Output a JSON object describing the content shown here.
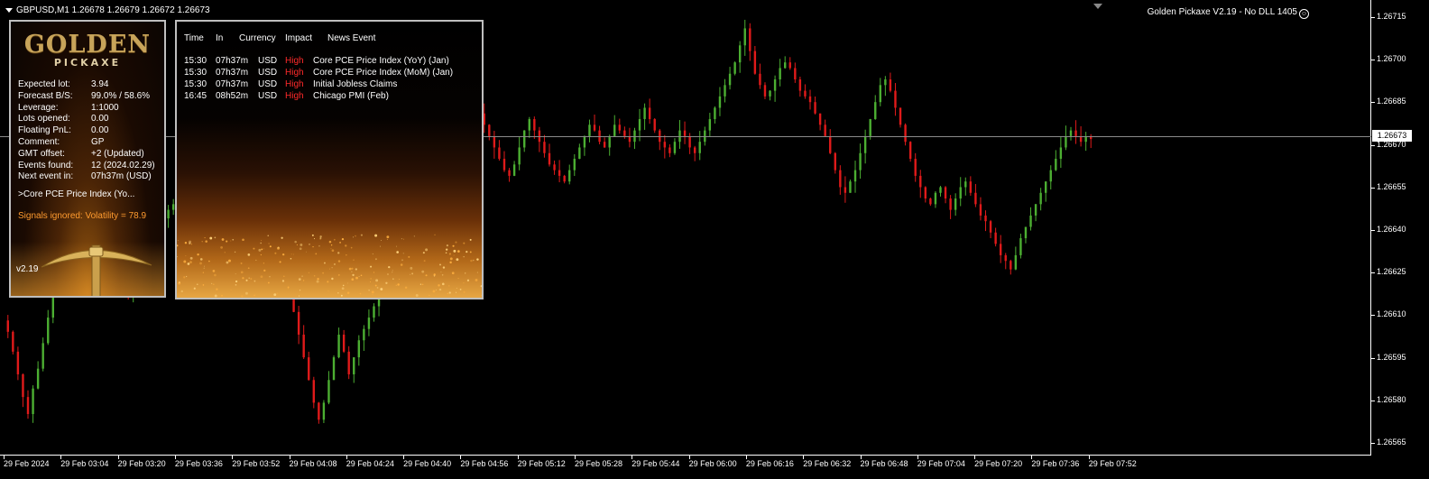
{
  "header": {
    "symbol_info": "GBPUSD,M1  1.26678 1.26679 1.26672 1.26673",
    "ea_title": "Golden Pickaxe V2.19 - No DLL 1405"
  },
  "price_axis": {
    "ticks": [
      "1.26715",
      "1.26700",
      "1.26685",
      "1.26670",
      "1.26655",
      "1.26640",
      "1.26625",
      "1.26610",
      "1.26595",
      "1.26580",
      "1.26565"
    ],
    "current_price": "1.26673"
  },
  "time_axis": {
    "ticks": [
      "29 Feb 2024",
      "29 Feb 03:04",
      "29 Feb 03:20",
      "29 Feb 03:36",
      "29 Feb 03:52",
      "29 Feb 04:08",
      "29 Feb 04:24",
      "29 Feb 04:40",
      "29 Feb 04:56",
      "29 Feb 05:12",
      "29 Feb 05:28",
      "29 Feb 05:44",
      "29 Feb 06:00",
      "29 Feb 06:16",
      "29 Feb 06:32",
      "29 Feb 06:48",
      "29 Feb 07:04",
      "29 Feb 07:20",
      "29 Feb 07:36",
      "29 Feb 07:52"
    ]
  },
  "colors": {
    "bull": "#4caf32",
    "bear": "#e01a1a",
    "accent": "#ff9b2f",
    "high_impact": "#ff2a2a"
  },
  "gp_panel": {
    "logo_main": "GOLDEN",
    "logo_sub": "PICKAXE",
    "rows": [
      {
        "label": "Expected lot:",
        "value": "3.94"
      },
      {
        "label": "Forecast B/S:",
        "value": "99.0% / 58.6%"
      },
      {
        "label": "Leverage:",
        "value": "1:1000"
      },
      {
        "label": "Lots opened:",
        "value": "0.00"
      },
      {
        "label": "Floating PnL:",
        "value": "0.00"
      },
      {
        "label": "Comment:",
        "value": "GP"
      },
      {
        "label": "GMT offset:",
        "value": "+2 (Updated)"
      },
      {
        "label": "Events found:",
        "value": "12 (2024.02.29)"
      },
      {
        "label": "Next event in:",
        "value": "07h37m (USD)"
      }
    ],
    "next_event": ">Core PCE Price Index (Yo...",
    "signal": "Signals ignored: Volatility = 78.9",
    "version": "v2.19"
  },
  "news_panel": {
    "headers": {
      "time": "Time",
      "in": "In",
      "currency": "Currency",
      "impact": "Impact",
      "event": "News Event"
    },
    "events": [
      {
        "time": "15:30",
        "in": "07h37m",
        "currency": "USD",
        "impact": "High",
        "event": "Core PCE Price Index (YoY) (Jan)"
      },
      {
        "time": "15:30",
        "in": "07h37m",
        "currency": "USD",
        "impact": "High",
        "event": "Core PCE Price Index (MoM) (Jan)"
      },
      {
        "time": "15:30",
        "in": "07h37m",
        "currency": "USD",
        "impact": "High",
        "event": "Initial Jobless Claims"
      },
      {
        "time": "16:45",
        "in": "08h52m",
        "currency": "USD",
        "impact": "High",
        "event": "Chicago PMI (Feb)"
      }
    ]
  },
  "chart_data": {
    "type": "candlestick",
    "timeframe": "M1",
    "ylim": [
      1.26562,
      1.26722
    ],
    "closes": [
      1.26605,
      1.26598,
      1.2659,
      1.26582,
      1.26576,
      1.26585,
      1.26592,
      1.26601,
      1.2661,
      1.26618,
      1.26625,
      1.2663,
      1.26636,
      1.26641,
      1.26645,
      1.2665,
      1.26648,
      1.26644,
      1.2664,
      1.26636,
      1.26632,
      1.26628,
      1.26624,
      1.2662,
      1.26618,
      1.26622,
      1.26626,
      1.2663,
      1.26634,
      1.26638,
      1.26642,
      1.26645,
      1.26648,
      1.2665,
      1.26652,
      1.26654,
      1.26656,
      1.26658,
      1.2666,
      1.26662,
      1.26664,
      1.26666,
      1.26668,
      1.2667,
      1.26668,
      1.26665,
      1.26662,
      1.2666,
      1.26658,
      1.26655,
      1.26652,
      1.2665,
      1.26646,
      1.2664,
      1.26634,
      1.26628,
      1.2662,
      1.26612,
      1.26604,
      1.26596,
      1.26588,
      1.2658,
      1.26574,
      1.2658,
      1.26588,
      1.26596,
      1.26604,
      1.26598,
      1.2659,
      1.26596,
      1.26602,
      1.26606,
      1.2661,
      1.26614,
      1.26618,
      1.26622,
      1.26626,
      1.26628,
      1.26632,
      1.26636,
      1.2664,
      1.26644,
      1.26648,
      1.26652,
      1.26656,
      1.2666,
      1.26664,
      1.26668,
      1.26672,
      1.26676,
      1.2668,
      1.26684,
      1.26688,
      1.26686,
      1.26682,
      1.26678,
      1.26674,
      1.2667,
      1.26666,
      1.26662,
      1.2666,
      1.26664,
      1.2667,
      1.26676,
      1.2668,
      1.26676,
      1.26672,
      1.26668,
      1.26664,
      1.26662,
      1.2666,
      1.26658,
      1.26662,
      1.26666,
      1.2667,
      1.26674,
      1.26678,
      1.26676,
      1.26672,
      1.2667,
      1.26674,
      1.26678,
      1.26676,
      1.26674,
      1.26672,
      1.26676,
      1.2668,
      1.26684,
      1.2668,
      1.26676,
      1.26672,
      1.2667,
      1.26668,
      1.26672,
      1.26676,
      1.26674,
      1.2667,
      1.26668,
      1.26672,
      1.26676,
      1.2668,
      1.26684,
      1.26688,
      1.26692,
      1.26696,
      1.267,
      1.26706,
      1.26712,
      1.26704,
      1.26696,
      1.26692,
      1.26688,
      1.2669,
      1.26694,
      1.26698,
      1.267,
      1.26698,
      1.26694,
      1.2669,
      1.26688,
      1.26686,
      1.26682,
      1.26678,
      1.26674,
      1.26668,
      1.26662,
      1.26656,
      1.26654,
      1.26658,
      1.26662,
      1.26668,
      1.26674,
      1.2668,
      1.26686,
      1.26692,
      1.26694,
      1.2669,
      1.26684,
      1.26678,
      1.26672,
      1.26666,
      1.2666,
      1.26656,
      1.26652,
      1.2665,
      1.26654,
      1.26656,
      1.26652,
      1.26648,
      1.26652,
      1.26656,
      1.26658,
      1.26654,
      1.2665,
      1.26646,
      1.26644,
      1.2664,
      1.26636,
      1.26632,
      1.2663,
      1.26627,
      1.26632,
      1.26638,
      1.26642,
      1.26646,
      1.2665,
      1.26654,
      1.26658,
      1.26662,
      1.26666,
      1.2667,
      1.26674,
      1.26676,
      1.26674,
      1.26672,
      1.26674,
      1.26673
    ]
  }
}
